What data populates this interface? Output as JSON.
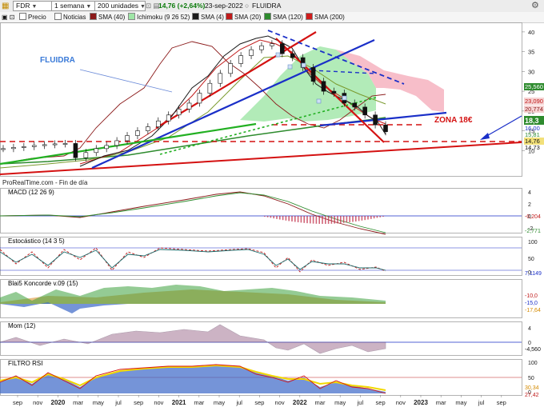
{
  "toolbar": {
    "symbol": "FDR",
    "period": "1 semana",
    "units": "200 unidades",
    "quote": "14,76 (+2,64%)",
    "date": "23-sep-2022",
    "name": "FLUIDRA"
  },
  "indicators_bar": [
    "Precio",
    "Noticias",
    "SMA (40)",
    "Ichimoku (9 26 52)",
    "SMA (4)",
    "SMA (20)",
    "SMA (120)",
    "SMA (200)"
  ],
  "colors": {
    "sma40": "#8b1a1a",
    "sma4": "#1a1a1a",
    "sma20": "#c01a1a",
    "sma120": "#2e8b2e",
    "sma200": "#d01c1c",
    "cloud_up": "#9fe6a6",
    "cloud_down": "#f6b3c0",
    "support": "#d41111",
    "trend_blue": "#1a2fc8",
    "macd_hist": "#c0304a"
  },
  "chart_data": {
    "type": "line",
    "title": "FLUIDRA",
    "source": "ProRealTime.com - Fin de día",
    "annotations": {
      "label": "FLUIDRA",
      "zone": "ZONA 18€"
    },
    "x_ticks": [
      "sep",
      "nov",
      "2020",
      "mar",
      "may",
      "jul",
      "sep",
      "nov",
      "2021",
      "mar",
      "may",
      "jul",
      "sep",
      "nov",
      "2022",
      "mar",
      "may",
      "jul",
      "sep",
      "nov",
      "2023",
      "mar",
      "may",
      "jul",
      "sep"
    ],
    "price_axis": {
      "ticks": [
        10,
        15,
        20,
        25,
        30,
        35,
        40
      ],
      "range": [
        4,
        42
      ]
    },
    "price_labels": [
      "25,560",
      "23,090",
      "20,774",
      "18,3",
      "16,00",
      "15,81",
      "14,76",
      "14,73"
    ],
    "price_series": {
      "name": "Precio",
      "x": [
        "2019-08",
        "2019-09",
        "2019-10",
        "2019-11",
        "2019-12",
        "2020-01",
        "2020-02",
        "2020-03",
        "2020-04",
        "2020-05",
        "2020-06",
        "2020-07",
        "2020-08",
        "2020-09",
        "2020-10",
        "2020-11",
        "2020-12",
        "2021-01",
        "2021-02",
        "2021-03",
        "2021-04",
        "2021-05",
        "2021-06",
        "2021-07",
        "2021-08",
        "2021-09",
        "2021-10",
        "2021-11",
        "2021-12",
        "2022-01",
        "2022-02",
        "2022-03",
        "2022-04",
        "2022-05",
        "2022-06",
        "2022-07",
        "2022-08",
        "2022-09"
      ],
      "values": [
        10.5,
        10.8,
        11.0,
        11.3,
        11.5,
        11.7,
        11.8,
        8.2,
        9.5,
        10.5,
        11.3,
        12.5,
        13.8,
        15.0,
        16.0,
        17.5,
        19.0,
        20.5,
        22.0,
        24.5,
        27.0,
        29.5,
        32.0,
        34.0,
        35.5,
        36.5,
        37.0,
        34.5,
        33.5,
        31.0,
        27.5,
        25.0,
        24.5,
        22.0,
        21.0,
        19.0,
        16.5,
        14.76
      ]
    },
    "macd": {
      "name": "MACD (12 26 9)",
      "labels": [
        "-0,204",
        "-2,771"
      ],
      "ticks": [
        4,
        2,
        0,
        -2
      ]
    },
    "stochastic": {
      "name": "Estocástico (14 3 5)",
      "labels": [
        "7,1149"
      ],
      "ticks": [
        100,
        50,
        0
      ]
    },
    "koncorde": {
      "name": "Blai5 Koncorde v.09 (15)",
      "labels": [
        "-10,0",
        "-15,0",
        "-17,64"
      ]
    },
    "momentum": {
      "name": "Mom (12)",
      "labels": [
        "-4,560"
      ],
      "ticks": [
        4,
        0
      ]
    },
    "filtro_rsi": {
      "name": "FILTRO RSI",
      "labels": [
        "30,34",
        "27,42"
      ],
      "ticks": [
        100,
        50,
        0
      ]
    }
  }
}
